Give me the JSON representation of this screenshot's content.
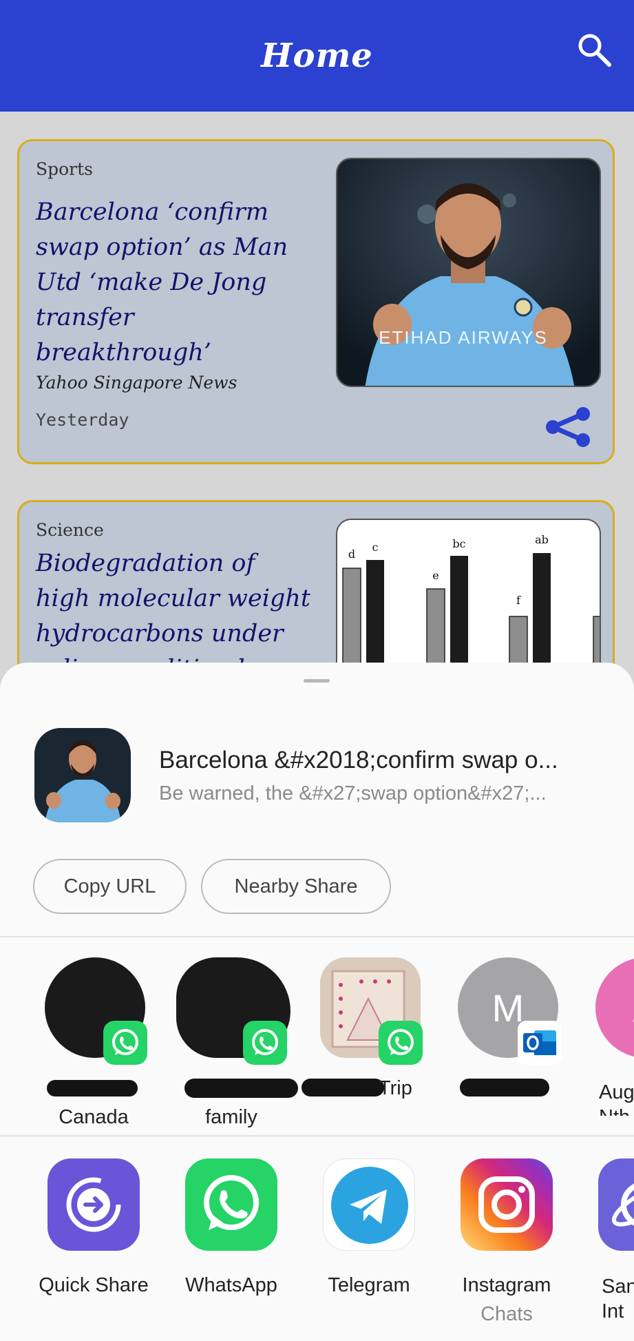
{
  "appbar": {
    "title": "Home"
  },
  "cards": [
    {
      "category": "Sports",
      "headline": "Barcelona ‘confirm swap option’ as Man Utd ‘make De Jong transfer breakthrough’",
      "source": "Yahoo Singapore News",
      "time": "Yesterday",
      "image_text": "ETIHAD AIRWAYS"
    },
    {
      "category": "Science",
      "headline": "Biodegradation of high molecular weight hydrocarbons under saline condition by",
      "chart_labels": [
        "d",
        "c",
        "e",
        "bc",
        "f",
        "ab"
      ]
    }
  ],
  "share_sheet": {
    "preview_title": "Barcelona &#x2018;confirm swap o...",
    "preview_subtitle": "Be warned, the &#x27;swap option&#x27;...",
    "chips": [
      "Copy URL",
      "Nearby Share"
    ],
    "contacts": [
      {
        "label": "Canada",
        "badge": "whatsapp-icon"
      },
      {
        "label": "family",
        "badge": "whatsapp-icon"
      },
      {
        "label": "Trip",
        "badge": "whatsapp-icon"
      },
      {
        "label": "",
        "initial": "M",
        "badge": "outlook-icon"
      },
      {
        "label": "Aug\nNth",
        "initial": "A"
      }
    ],
    "apps": [
      {
        "name": "Quick Share",
        "sub": ""
      },
      {
        "name": "WhatsApp",
        "sub": ""
      },
      {
        "name": "Telegram",
        "sub": ""
      },
      {
        "name": "Instagram",
        "sub": "Chats"
      },
      {
        "name": "San\nInt",
        "sub": ""
      }
    ]
  },
  "colors": {
    "appbar": "#2b41cf",
    "card_bg": "#bdc6d2",
    "card_border": "#d9ad1b",
    "headline": "#13136b",
    "share_icon": "#2b41cf",
    "whatsapp": "#25d366"
  }
}
